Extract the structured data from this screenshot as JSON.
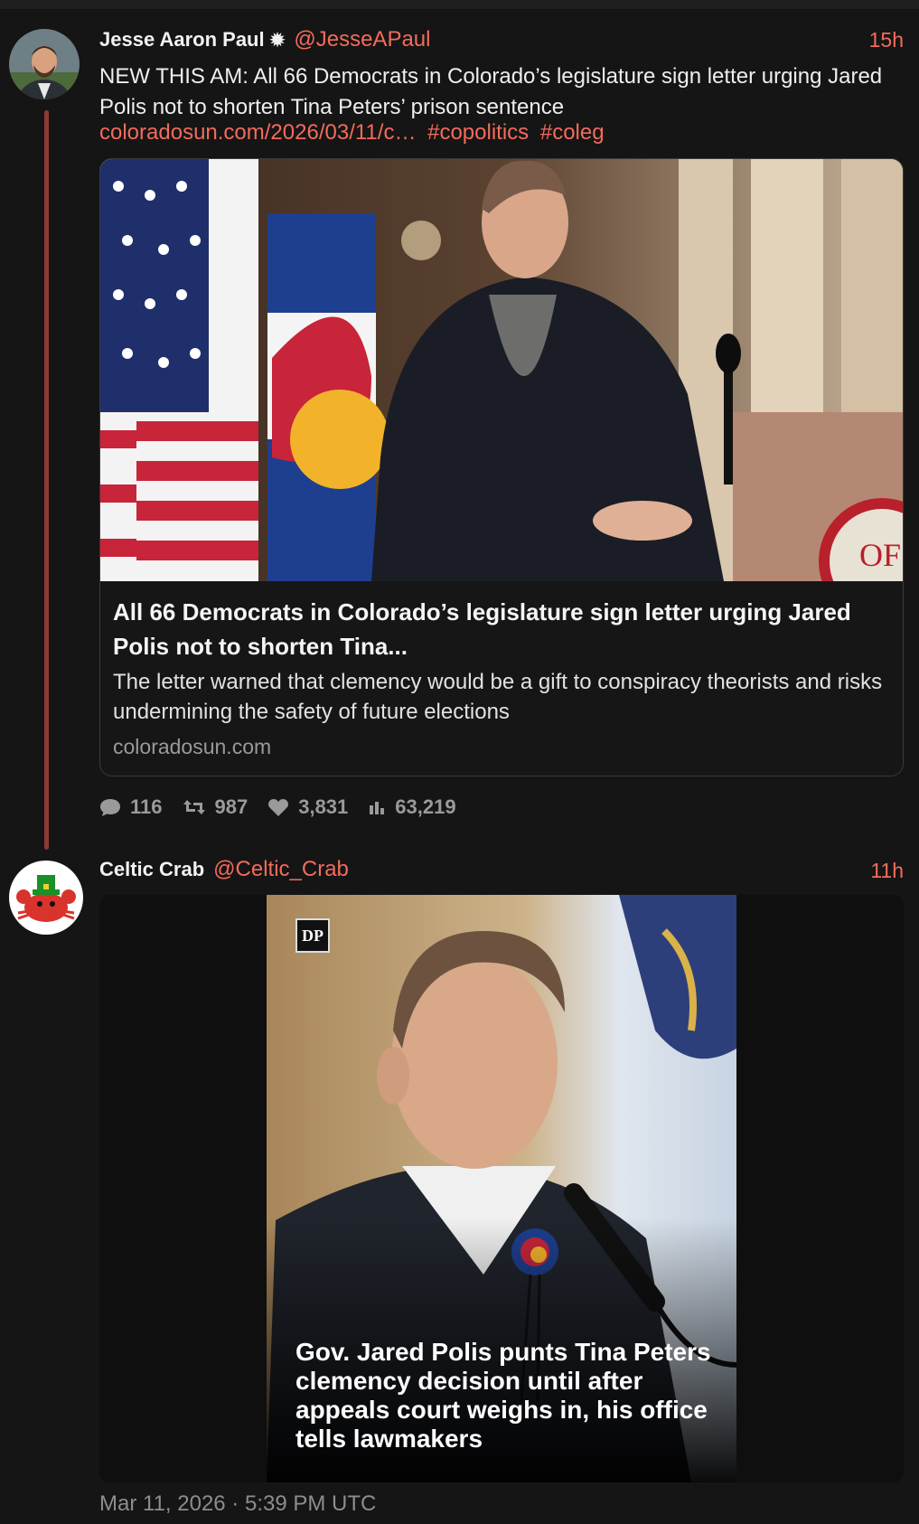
{
  "tweet1": {
    "author_name": "Jesse Aaron Paul",
    "author_badge": "✹",
    "handle": "@JesseAPaul",
    "time": "15h",
    "text": "NEW THIS AM: All 66 Democrats in Colorado’s legislature sign letter urging Jared Polis not to shorten Tina Peters’ prison sentence",
    "link": "coloradosun.com/2026/03/11/c…",
    "hashtags": [
      "#copolitics",
      "#coleg"
    ],
    "card": {
      "title": "All 66 Democrats in Colorado’s legislature sign letter urging Jared Polis not to shorten Tina...",
      "description": "The letter warned that clemency would be a gift to conspiracy theorists and risks undermining the safety of future elections",
      "domain": "coloradosun.com",
      "image_icon": "news-photo-icon"
    },
    "stats": {
      "replies": "116",
      "retweets": "987",
      "likes": "3,831",
      "views": "63,219"
    }
  },
  "tweet2": {
    "author_name": "Celtic Crab",
    "handle": "@Celtic_Crab",
    "time": "11h",
    "media": {
      "logo_text": "DP",
      "overlay_text": "Gov. Jared Polis punts Tina Peters clemency decision until after appeals court weighs in, his office tells lawmakers"
    },
    "timestamp": "Mar 11, 2026 · 5:39 PM UTC"
  },
  "colors": {
    "accent": "#f36b5c",
    "background": "#151515",
    "thread_line": "#8c3a33",
    "muted": "#9a9a9a"
  }
}
